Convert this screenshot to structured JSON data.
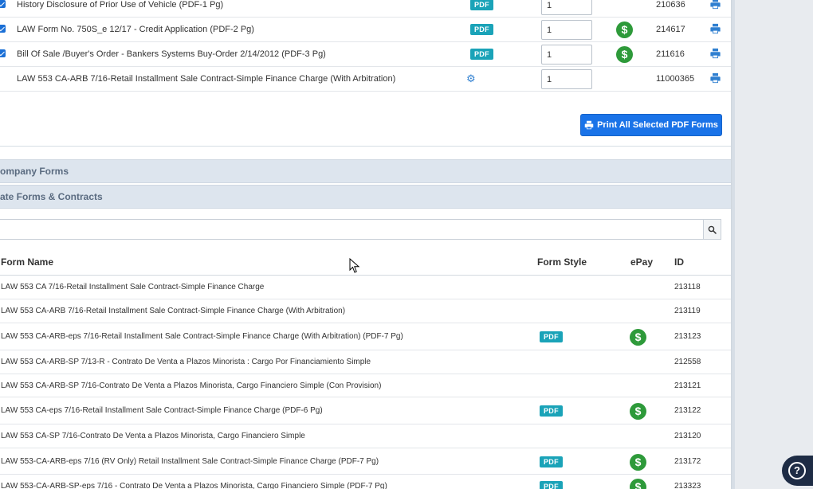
{
  "selected_forms": [
    {
      "name": "History Disclosure of Prior Use of Vehicle (PDF-1 Pg)",
      "style": "PDF",
      "qty": "1",
      "epay": false,
      "id": "210636",
      "checked": true
    },
    {
      "name": "LAW Form No. 750S_e 12/17 - Credit Application (PDF-2 Pg)",
      "style": "PDF",
      "qty": "1",
      "epay": true,
      "id": "214617",
      "checked": true
    },
    {
      "name": "Bill Of Sale /Buyer's Order - Bankers Systems Buy-Order 2/14/2012 (PDF-3 Pg)",
      "style": "PDF",
      "qty": "1",
      "epay": true,
      "id": "211616",
      "checked": true
    },
    {
      "name": "LAW 553 CA-ARB 7/16-Retail Installment Sale Contract-Simple Finance Charge (With Arbitration)",
      "style": "gear",
      "qty": "1",
      "epay": false,
      "id": "11000365",
      "checked": false
    }
  ],
  "print_all_button": "Print All Selected PDF Forms",
  "sections": {
    "company_forms": "ompany Forms",
    "state_forms": "ate Forms & Contracts"
  },
  "search": {
    "value": "",
    "placeholder": ""
  },
  "table": {
    "headers": {
      "name": "Form Name",
      "style": "Form Style",
      "epay": "ePay",
      "id": "ID"
    },
    "rows": [
      {
        "name": "LAW 553 CA 7/16-Retail Installment Sale Contract-Simple Finance Charge",
        "style": "",
        "epay": false,
        "id": "213118"
      },
      {
        "name": "LAW 553 CA-ARB 7/16-Retail Installment Sale Contract-Simple Finance Charge (With Arbitration)",
        "style": "",
        "epay": false,
        "id": "213119"
      },
      {
        "name": "LAW 553 CA-ARB-eps 7/16-Retail Installment Sale Contract-Simple Finance Charge (With Arbitration) (PDF-7 Pg)",
        "style": "PDF",
        "epay": true,
        "id": "213123"
      },
      {
        "name": "LAW 553 CA-ARB-SP 7/13-R - Contrato De Venta a Plazos Minorista : Cargo Por Financiamiento Simple",
        "style": "",
        "epay": false,
        "id": "212558"
      },
      {
        "name": "LAW 553 CA-ARB-SP 7/16-Contrato De Venta a Plazos Minorista, Cargo Financiero Simple (Con Provision)",
        "style": "",
        "epay": false,
        "id": "213121"
      },
      {
        "name": "LAW 553 CA-eps 7/16-Retail Installment Sale Contract-Simple Finance Charge (PDF-6 Pg)",
        "style": "PDF",
        "epay": true,
        "id": "213122"
      },
      {
        "name": "LAW 553 CA-SP 7/16-Contrato De Venta a Plazos Minorista, Cargo Financiero Simple",
        "style": "",
        "epay": false,
        "id": "213120"
      },
      {
        "name": "LAW 553-CA-ARB-eps 7/16 (RV Only) Retail Installment Sale Contract-Simple Finance Charge (PDF-7 Pg)",
        "style": "PDF",
        "epay": true,
        "id": "213172"
      },
      {
        "name": "LAW 553-CA-ARB-SP-eps 7/16 - Contrato De Venta a Plazos Minorista, Cargo Financiero Simple (PDF-7 Pg)",
        "style": "PDF",
        "epay": true,
        "id": "213323"
      }
    ]
  },
  "help_label": "?",
  "epay_symbol": "$",
  "gear_symbol": "⚙",
  "colors": {
    "accent": "#1a73e8",
    "pdf_badge": "#1aa3b8",
    "epay": "#2e9a3a",
    "section_header": "#dde5ee"
  }
}
